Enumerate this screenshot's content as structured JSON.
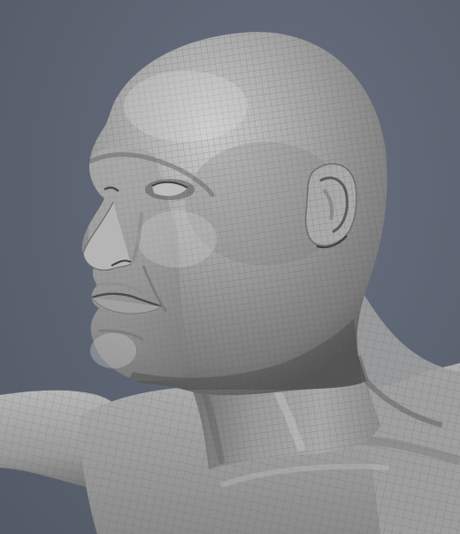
{
  "viewport": {
    "background_color": "#5b6270",
    "subject": "sculpted-head-wireframe-mesh",
    "mesh_color": "#9c9c9c",
    "wire_color": "#5e5e5e",
    "highlight_color": "#d0d0d0",
    "shadow_color": "#3a3a3a"
  }
}
